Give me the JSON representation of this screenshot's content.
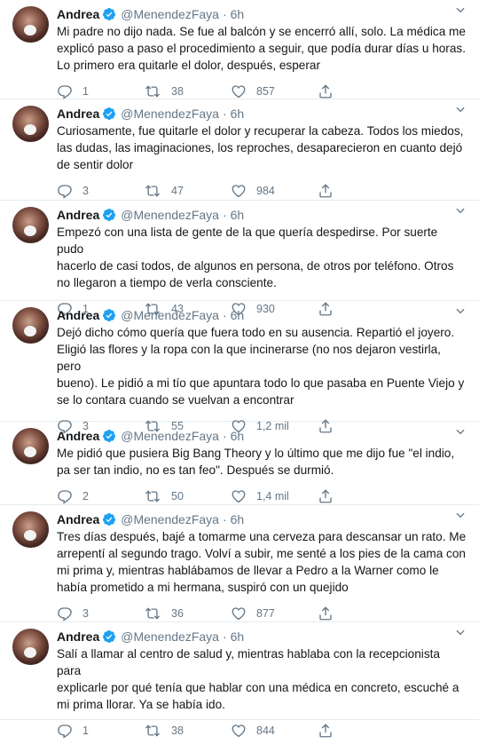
{
  "tweets": [
    {
      "name": "Andrea",
      "handle": "@MenendezFaya",
      "time": "6h",
      "text": "Mi padre no dijo nada. Se fue al balcón y se encerró allí, solo. La médica me\nexplicó paso a paso el procedimiento a seguir, que podía durar días u horas.\nLo primero era quitarle el dolor, después, esperar",
      "replies": "1",
      "retweets": "38",
      "likes": "857"
    },
    {
      "name": "Andrea",
      "handle": "@MenendezFaya",
      "time": "6h",
      "text": "Curiosamente, fue quitarle el dolor y recuperar la cabeza. Todos los miedos,\nlas dudas, las imaginaciones, los reproches, desaparecieron en cuanto dejó\nde sentir dolor",
      "replies": "3",
      "retweets": "47",
      "likes": "984"
    },
    {
      "name": "Andrea",
      "handle": "@MenendezFaya",
      "time": "6h",
      "text": "Empezó con una lista de gente de la que quería despedirse. Por suerte pudo\nhacerlo de casi todos, de algunos en persona, de otros por teléfono. Otros\nno llegaron a tiempo de verla consciente.",
      "replies": "1",
      "retweets": "43",
      "likes": "930"
    },
    {
      "name": "Andrea",
      "handle": "@MenendezFaya",
      "time": "6h",
      "text": "Dejó dicho cómo quería que fuera todo en su ausencia. Repartió el joyero.\nEligió las flores y la ropa con la que incinerarse (no nos dejaron vestirla, pero\nbueno). Le pidió a mi tío que apuntara todo lo que pasaba en Puente Viejo y\nse lo contara cuando se vuelvan a encontrar",
      "replies": "3",
      "retweets": "55",
      "likes": "1,2 mil"
    },
    {
      "name": "Andrea",
      "handle": "@MenendezFaya",
      "time": "6h",
      "text": "Me pidió que pusiera Big Bang Theory y lo último que me dijo fue \"el indio,\npa ser tan indio, no es tan feo\". Después se durmió.",
      "replies": "2",
      "retweets": "50",
      "likes": "1,4 mil"
    },
    {
      "name": "Andrea",
      "handle": "@MenendezFaya",
      "time": "6h",
      "text": "Tres días después, bajé a tomarme una cerveza para descansar un rato. Me\narrepentí al segundo trago. Volví a subir, me senté a los pies de la cama con\nmi prima y, mientras hablábamos de llevar a Pedro a la Warner como le\nhabía prometido a mi hermana, suspiró con un quejido",
      "replies": "3",
      "retweets": "36",
      "likes": "877"
    },
    {
      "name": "Andrea",
      "handle": "@MenendezFaya",
      "time": "6h",
      "text": "Salí a llamar al centro de salud y, mientras hablaba con la recepcionista para\nexplicarle por qué tenía que hablar con una médica en concreto, escuché a\nmi prima llorar. Ya se había ido.",
      "replies": "1",
      "retweets": "38",
      "likes": "844"
    }
  ],
  "colors": {
    "text": "#14171a",
    "muted": "#657786",
    "verified": "#1da1f2",
    "divider": "#e6ecf0"
  },
  "icons": [
    "verified-badge-icon",
    "chevron-down-icon",
    "reply-icon",
    "retweet-icon",
    "like-icon",
    "share-icon"
  ]
}
